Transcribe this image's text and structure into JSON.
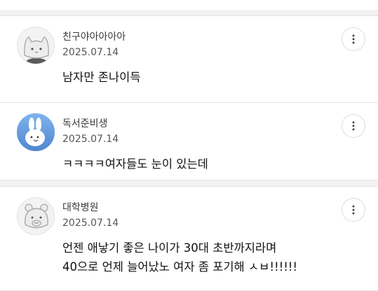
{
  "comments": [
    {
      "author": "친구야아아아아",
      "date": "2025.07.14",
      "lines": [
        "남자만 존나이득"
      ],
      "avatar_icon": "cat-icon"
    },
    {
      "author": "독서준비생",
      "date": "2025.07.14",
      "lines": [
        "ㅋㅋㅋㅋ여자들도 눈이 있는데"
      ],
      "avatar_icon": "bunny-icon"
    },
    {
      "author": "대학병원",
      "date": "2025.07.14",
      "lines": [
        "언젠 애낳기 좋은 나이가 30대 초반까지라며",
        "40으로 언제 늘어났노 여자 좀 포기해 ㅅㅂ!!!!!!"
      ],
      "avatar_icon": "hamster-icon"
    }
  ],
  "more_icon": "more-vertical-icon",
  "colors": {
    "divider": "#e3e3e6",
    "background": "#f2f2f4",
    "sky_avatar": "#6ea8e6"
  }
}
